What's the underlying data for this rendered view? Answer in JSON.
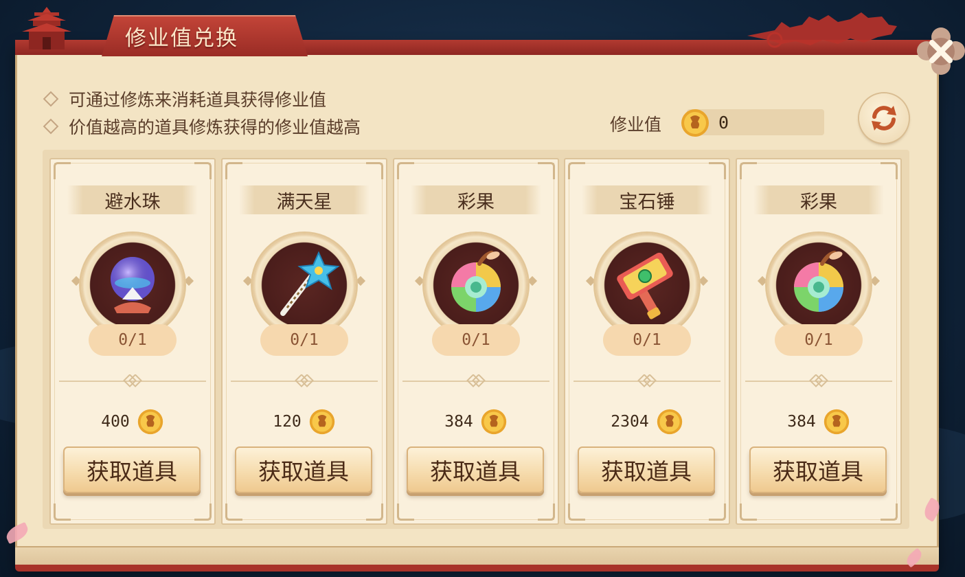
{
  "dialog": {
    "title": "修业值兑换",
    "info_lines": [
      "可通过修炼来消耗道具获得修业值",
      "价值越高的道具修炼获得的修业值越高"
    ],
    "xiuye_label": "修业值",
    "xiuye_value": "0",
    "close_icon": "close-x-icon",
    "refresh_icon": "refresh-icon"
  },
  "items": [
    {
      "name": "避水珠",
      "count": "0/1",
      "price": "400",
      "button": "获取道具",
      "icon": "water-pearl-icon"
    },
    {
      "name": "满天星",
      "count": "0/1",
      "price": "120",
      "button": "获取道具",
      "icon": "star-wand-icon"
    },
    {
      "name": "彩果",
      "count": "0/1",
      "price": "384",
      "button": "获取道具",
      "icon": "rainbow-fruit-icon"
    },
    {
      "name": "宝石锤",
      "count": "0/1",
      "price": "2304",
      "button": "获取道具",
      "icon": "gem-hammer-icon"
    },
    {
      "name": "彩果",
      "count": "0/1",
      "price": "384",
      "button": "获取道具",
      "icon": "rainbow-fruit-icon"
    }
  ],
  "colors": {
    "title_red": "#a8332a",
    "panel_bg": "#f3e4c4",
    "card_bg": "#faf0dc",
    "button_gold": "#f6dcae",
    "count_pill": "#f6d8ae"
  }
}
